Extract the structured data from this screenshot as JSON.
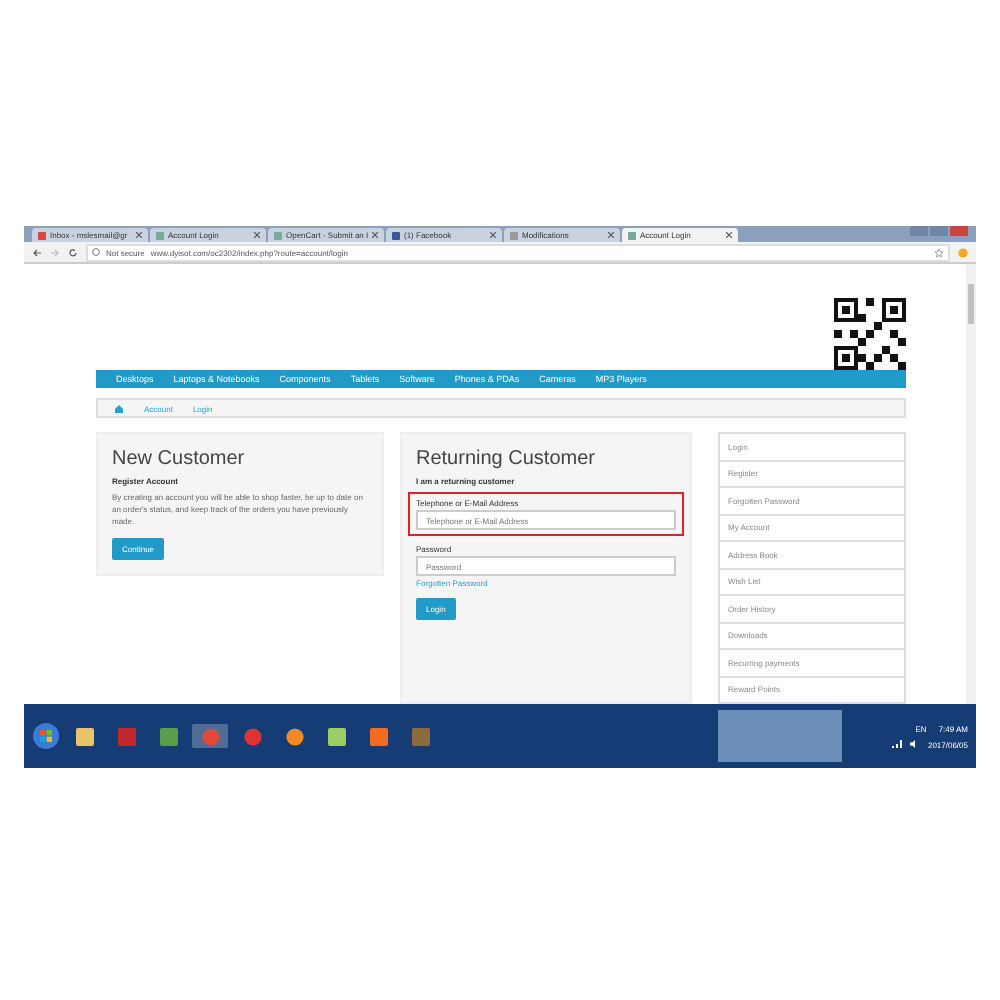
{
  "browser": {
    "tabs": [
      {
        "label": "Inbox - mslesmail@gr",
        "kind": "mail",
        "selected": false
      },
      {
        "label": "Account Login",
        "kind": "page",
        "selected": false
      },
      {
        "label": "OpenCart - Submit an I",
        "kind": "page",
        "selected": false
      },
      {
        "label": "(1) Facebook",
        "kind": "facebook",
        "selected": false
      },
      {
        "label": "Modifications",
        "kind": "doc",
        "selected": false
      },
      {
        "label": "Account Login",
        "kind": "page",
        "selected": true
      }
    ],
    "security": "Not secure",
    "url": "www.dyisot.com/oc2302/index.php?route=account/login"
  },
  "nav": [
    "Desktops",
    "Laptops & Notebooks",
    "Components",
    "Tablets",
    "Software",
    "Phones & PDAs",
    "Cameras",
    "MP3 Players"
  ],
  "breadcrumb": [
    "Account",
    "Login"
  ],
  "new_customer": {
    "title": "New Customer",
    "subtitle": "Register Account",
    "text": "By creating an account you will be able to shop faster, be up to date on an order's status, and keep track of the orders you have previously made.",
    "button": "Continue"
  },
  "returning": {
    "title": "Returning Customer",
    "subtitle": "I am a returning customer",
    "email_label": "Telephone or E-Mail Address",
    "email_placeholder": "Telephone or E-Mail Address",
    "highlighted": true,
    "password_label": "Password",
    "password_placeholder": "Password",
    "forgot": "Forgotten Password",
    "button": "Login"
  },
  "sidebar": [
    "Login",
    "Register",
    "Forgotten Password",
    "My Account",
    "Address Book",
    "Wish List",
    "Order History",
    "Downloads",
    "Recurring payments",
    "Reward Points"
  ],
  "taskbar": {
    "apps": [
      {
        "kind": "folder",
        "selected": false
      },
      {
        "kind": "filezilla",
        "selected": false
      },
      {
        "kind": "image",
        "selected": false
      },
      {
        "kind": "chrome",
        "selected": true
      },
      {
        "kind": "ball",
        "selected": false
      },
      {
        "kind": "firefox",
        "selected": false
      },
      {
        "kind": "notes",
        "selected": false
      },
      {
        "kind": "xampp",
        "selected": false
      },
      {
        "kind": "app",
        "selected": false
      }
    ],
    "language": "EN",
    "time": "7:49 AM",
    "date": "2017/06/05"
  }
}
